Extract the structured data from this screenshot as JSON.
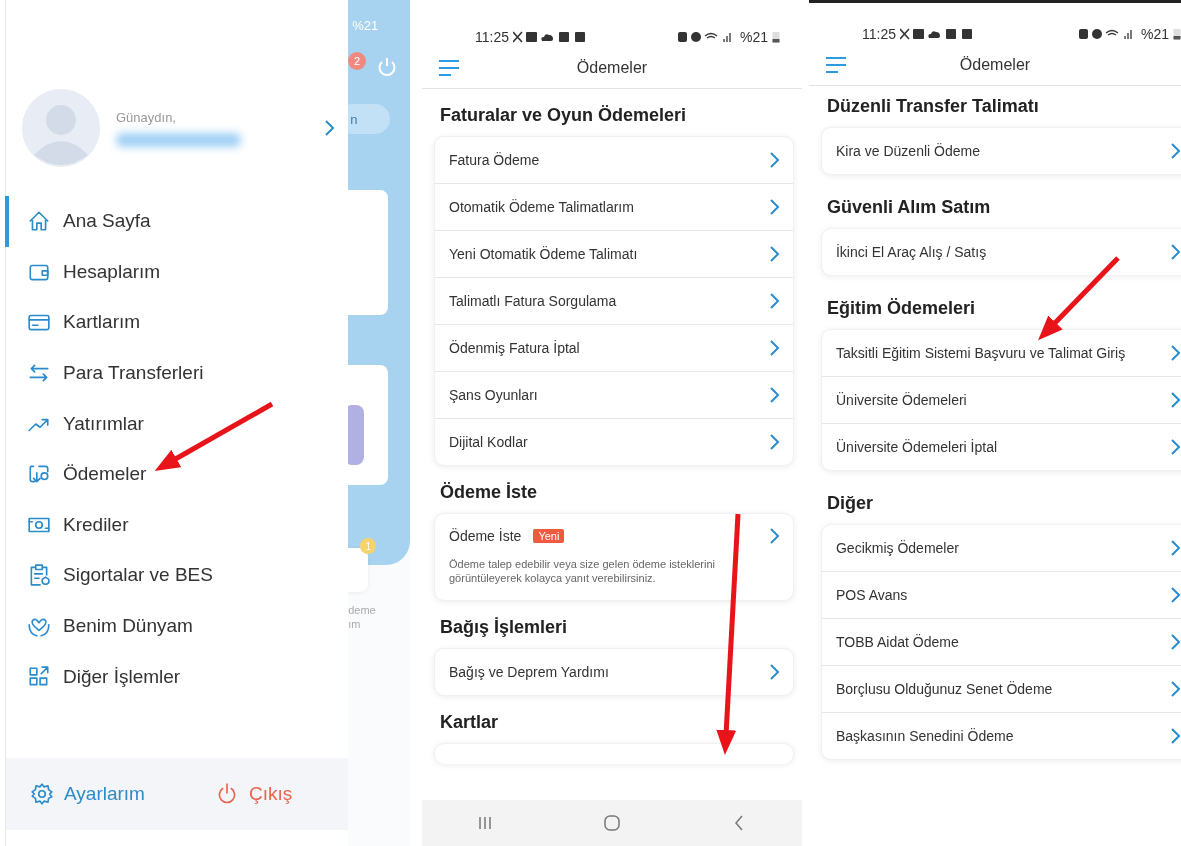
{
  "drawer": {
    "greeting": "Günaydın,",
    "items": [
      {
        "label": "Ana Sayfa",
        "selected": true
      },
      {
        "label": "Hesaplarım",
        "selected": false
      },
      {
        "label": "Kartlarım",
        "selected": false
      },
      {
        "label": "Para Transferleri",
        "selected": false
      },
      {
        "label": "Yatırımlar",
        "selected": false
      },
      {
        "label": "Ödemeler",
        "selected": false
      },
      {
        "label": "Krediler",
        "selected": false
      },
      {
        "label": "Sigortalar ve BES",
        "selected": false
      },
      {
        "label": "Benim Dünyam",
        "selected": false
      },
      {
        "label": "Diğer İşlemler",
        "selected": false
      }
    ],
    "settings": "Ayarlarım",
    "logout": "Çıkış"
  },
  "background_app": {
    "battery": "%21",
    "notification_count": "2",
    "search_fragment": "n",
    "tile_badge": "1",
    "tile_label": [
      "deme",
      "ım"
    ]
  },
  "screens": [
    {
      "time": "11:25",
      "battery": "%21",
      "title": "Ödemeler",
      "sections": [
        {
          "title": "Faturalar ve Oyun Ödemeleri",
          "items": [
            {
              "label": "Fatura Ödeme"
            },
            {
              "label": "Otomatik Ödeme Talimatlarım"
            },
            {
              "label": "Yeni Otomatik Ödeme Talimatı"
            },
            {
              "label": "Talimatlı Fatura Sorgulama"
            },
            {
              "label": "Ödenmiş Fatura İptal"
            },
            {
              "label": "Şans Oyunları"
            },
            {
              "label": "Dijital Kodlar"
            }
          ]
        },
        {
          "title": "Ödeme İste",
          "items": [
            {
              "label": "Ödeme İste",
              "badge": "Yeni",
              "description": "Ödeme talep edebilir veya size gelen ödeme isteklerini görüntüleyerek kolayca yanıt verebilirsiniz."
            }
          ]
        },
        {
          "title": "Bağış İşlemleri",
          "items": [
            {
              "label": "Bağış ve Deprem Yardımı"
            }
          ]
        },
        {
          "title": "Kartlar"
        }
      ]
    },
    {
      "time": "11:25",
      "battery": "%21",
      "title": "Ödemeler",
      "sections": [
        {
          "title": "Düzenli Transfer Talimatı",
          "items": [
            {
              "label": "Kira ve Düzenli Ödeme"
            }
          ]
        },
        {
          "title": "Güvenli Alım Satım",
          "items": [
            {
              "label": "İkinci El Araç Alış / Satış"
            }
          ]
        },
        {
          "title": "Eğitim Ödemeleri",
          "items": [
            {
              "label": "Taksitli Eğitim Sistemi Başvuru ve Talimat Giriş"
            },
            {
              "label": "Üniversite Ödemeleri"
            },
            {
              "label": "Üniversite Ödemeleri İptal"
            }
          ]
        },
        {
          "title": "Diğer",
          "items": [
            {
              "label": "Gecikmiş Ödemeler"
            },
            {
              "label": "POS Avans"
            },
            {
              "label": "TOBB Aidat Ödeme"
            },
            {
              "label": "Borçlusu Olduğunuz Senet Ödeme"
            },
            {
              "label": "Başkasının Senedini Ödeme"
            }
          ]
        }
      ]
    }
  ]
}
